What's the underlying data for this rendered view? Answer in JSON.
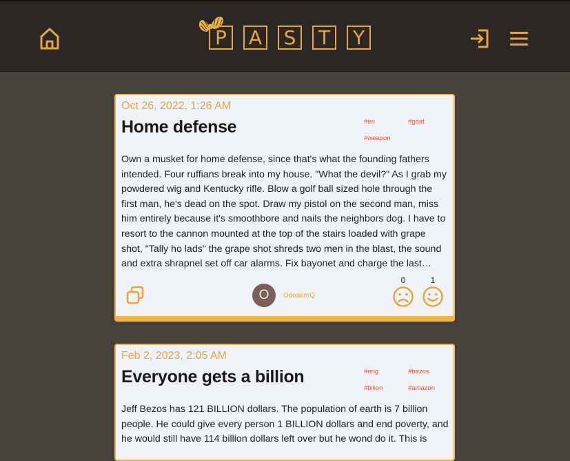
{
  "header": {
    "logo_letters": [
      "P",
      "A",
      "S",
      "T",
      "Y"
    ],
    "home_icon": "home-icon",
    "login_icon": "login-icon",
    "menu_icon": "hamburger-menu-icon",
    "accent_color": "#e8a63a"
  },
  "posts": [
    {
      "date": "Oct 26, 2022, 1:26 AM",
      "title": "Home defense",
      "tags": [
        "#en",
        "#goat",
        "#weapon"
      ],
      "body": "Own a musket for home defense, since that's what the founding fathers intended. Four ruffians break into my house. \"What the devil?\" As I grab my powdered wig and Kentucky rifle. Blow a golf ball sized hole through the first man, he's dead on the spot. Draw my pistol on the second man, miss him entirely because it's smoothbore and nails the neighbors dog. I have to resort to the cannon mounted at the top of the stairs loaded with grape shot, \"Tally ho lads\" the grape shot shreds two men in the blast, the sound and extra shrapnel set off car alarms. Fix bayonet and charge the last…",
      "author_initial": "O",
      "author": "OdoakerQ",
      "sad_count": "0",
      "happy_count": "1"
    },
    {
      "date": "Feb 2, 2023, 2:05 AM",
      "title": "Everyone gets a billion",
      "tags": [
        "#eng",
        "#bezos",
        "#bilion",
        "#amazon"
      ],
      "body": "Jeff Bezos has 121 BILLION dollars. The population of earth is 7 billion people. He could give every person 1 BILLION dollars and end poverty, and he would still have 114 billion dollars left over but he wond do it. This is"
    }
  ]
}
